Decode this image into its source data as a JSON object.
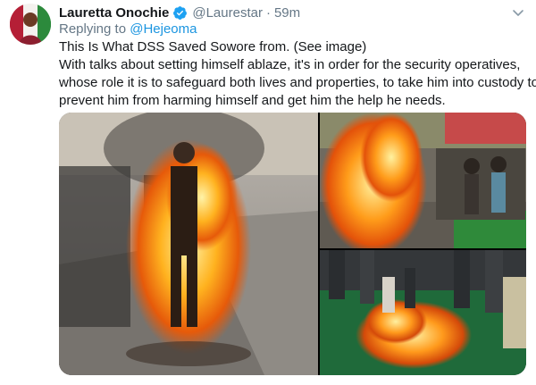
{
  "tweet": {
    "author": {
      "display_name": "Lauretta Onochie",
      "handle": "@Laurestar",
      "verified": true,
      "avatar_icon": "profile-photo"
    },
    "separator": "·",
    "timestamp": "59m",
    "reply": {
      "prefix": "Replying to",
      "mention": "@Hejeoma"
    },
    "text_lines": [
      "This Is What DSS Saved Sowore from. (See image)",
      "With talks about setting himself ablaze, it's in order for the security operatives,",
      "whose role it is to safeguard both lives and properties, to take him into custody to",
      "prevent him from harming himself and get him the help he needs."
    ],
    "media": {
      "count": 3,
      "icons": [
        "burning-man-photo",
        "fire-street-photo",
        "fire-ground-photo"
      ]
    },
    "colors": {
      "link": "#1b95e0",
      "verified": "#1da1f2",
      "secondary_text": "#657786",
      "primary_text": "#14171a"
    }
  }
}
